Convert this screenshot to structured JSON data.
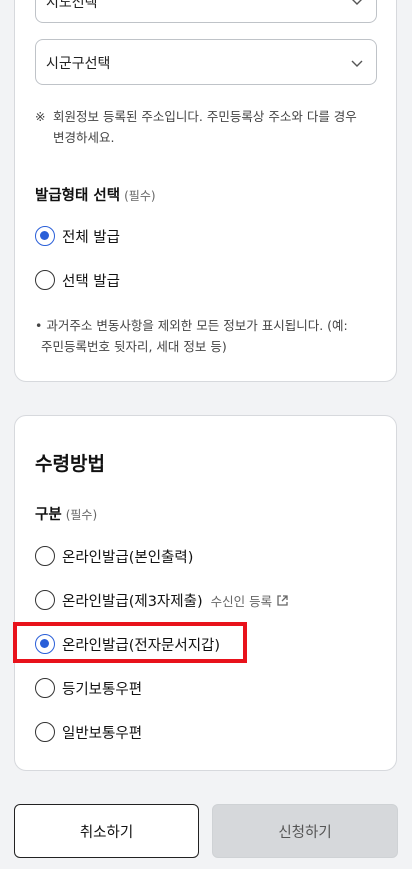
{
  "address": {
    "sido_select": "시도선택",
    "sigungu_select": "시군구선택",
    "notice_mark": "※",
    "notice_line1": "회원정보 등록된 주소입니다. 주민등록상 주소와 다를 경우",
    "notice_line2": "변경하세요."
  },
  "issue_type": {
    "label": "발급형태 선택",
    "required": "(필수)",
    "options": [
      "전체 발급",
      "선택 발급"
    ],
    "selected": "전체 발급",
    "note_line1": "• 과거주소 변동사항을 제외한 모든 정보가 표시됩니다. (예:",
    "note_line2": "주민등록번호 뒷자리, 세대 정보 등)"
  },
  "receive": {
    "title": "수령방법",
    "label": "구분",
    "required": "(필수)",
    "options": [
      "온라인발급(본인출력)",
      "온라인발급(제3자제출)",
      "온라인발급(전자문서지갑)",
      "등기보통우편",
      "일반보통우편"
    ],
    "selected": "온라인발급(전자문서지갑)",
    "recipient_link": "수신인 등록"
  },
  "buttons": {
    "cancel": "취소하기",
    "submit": "신청하기"
  },
  "colors": {
    "accent": "#2a5fd8",
    "highlight": "#e8121b"
  }
}
